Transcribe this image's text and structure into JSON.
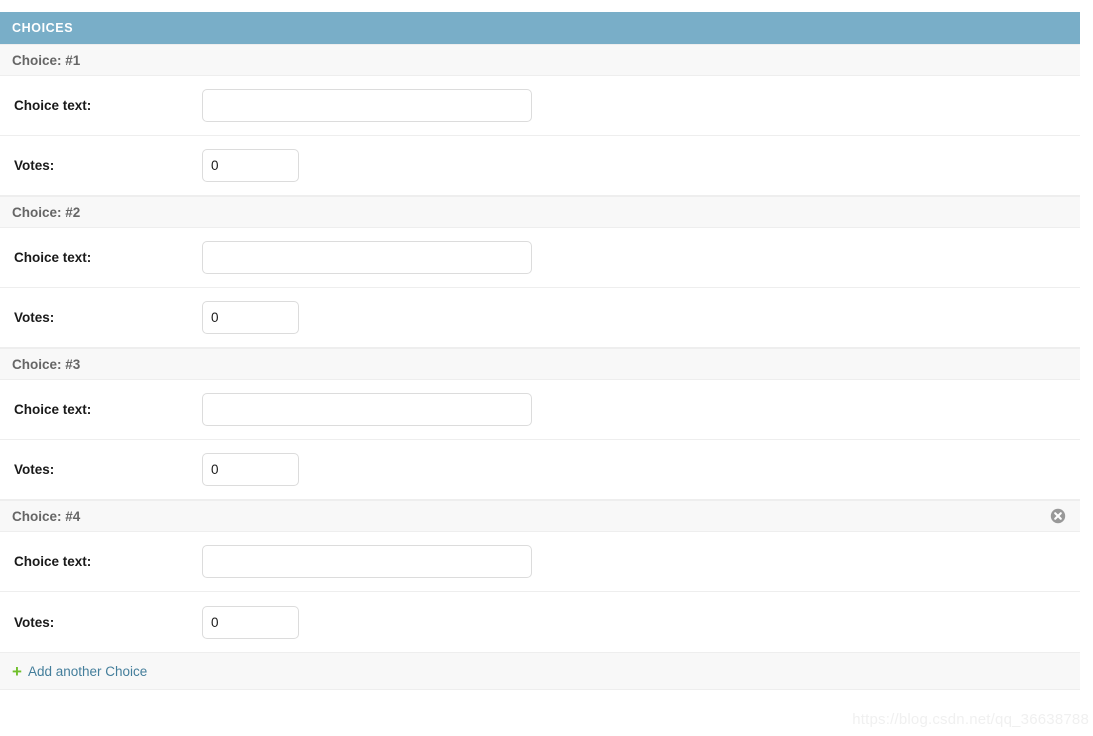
{
  "module": {
    "header_title": "CHOICES"
  },
  "labels": {
    "choice_text": "Choice text:",
    "votes": "Votes:"
  },
  "choices": [
    {
      "header": "Choice: #1",
      "choice_text_value": "",
      "choice_text_placeholder": "",
      "votes_value": "0",
      "deletable": false
    },
    {
      "header": "Choice: #2",
      "choice_text_value": "",
      "choice_text_placeholder": "",
      "votes_value": "0",
      "deletable": false
    },
    {
      "header": "Choice: #3",
      "choice_text_value": "",
      "choice_text_placeholder": "",
      "votes_value": "0",
      "deletable": false
    },
    {
      "header": "Choice: #4",
      "choice_text_value": "",
      "choice_text_placeholder": "",
      "votes_value": "0",
      "deletable": true,
      "delete_icon": "circle-x-icon"
    }
  ],
  "add_another": {
    "icon": "plus-icon",
    "plus_glyph": "+",
    "label": "Add another Choice"
  },
  "watermark": {
    "text": "https://blog.csdn.net/qq_36638788"
  },
  "colors": {
    "header_blue": "#79aec8",
    "row_gray": "#f8f8f8",
    "link_blue": "#447e9b",
    "plus_green": "#70bf2b",
    "border_gray": "#eeeeee",
    "input_border": "#dcdcdc",
    "delete_gray": "#999999"
  }
}
